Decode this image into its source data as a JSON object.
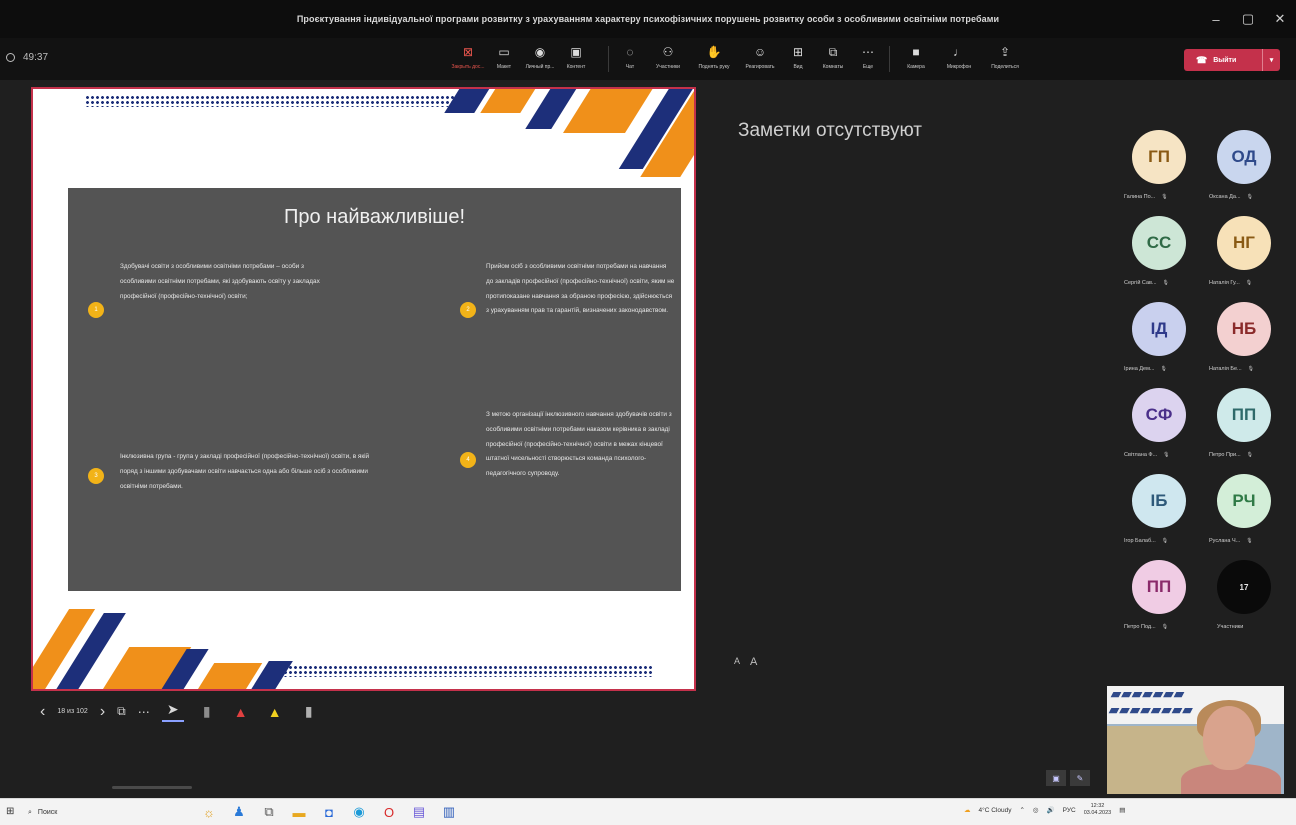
{
  "window": {
    "title": "Проєктування індивідуальної програми розвитку з урахуванням характеру психофізичних порушень розвитку особи з особливими освітніми потребами",
    "minimize": "–",
    "maximize": "▢",
    "close": "✕"
  },
  "toolbar": {
    "timer": "49:37",
    "items": [
      {
        "label": "Закрыть дос...",
        "icon": "share-screen-icon"
      },
      {
        "label": "Макет",
        "icon": "layout-icon"
      },
      {
        "label": "Личный пр...",
        "icon": "broadcast-icon"
      },
      {
        "label": "Контент",
        "icon": "content-icon"
      },
      {
        "label": "Чат",
        "icon": "chat-icon"
      },
      {
        "label": "Участники",
        "icon": "people-icon"
      },
      {
        "label": "Поднять руку",
        "icon": "hand-icon"
      },
      {
        "label": "Реагировать",
        "icon": "emoji-icon"
      },
      {
        "label": "Вид",
        "icon": "grid-icon"
      },
      {
        "label": "Комнаты",
        "icon": "rooms-icon"
      },
      {
        "label": "Еще",
        "icon": "more-icon"
      },
      {
        "label": "Камера",
        "icon": "camera-icon"
      },
      {
        "label": "Микрофон",
        "icon": "mic-icon"
      },
      {
        "label": "Поделиться",
        "icon": "upload-icon"
      }
    ],
    "leave_label": "Выйти"
  },
  "slide": {
    "title": "Про найважливіше!",
    "bullets": [
      {
        "num": "1",
        "text": "Здобувачі освіти з особливими освітніми потребами – особи з особливими освітніми потребами, які здобувають освіту у закладах професійної (професійно-технічної) освіти;"
      },
      {
        "num": "2",
        "text": "Прийом осіб з особливими освітніми потребами на навчання до закладів професійної (професійно-технічної) освіти, яким не протипоказане навчання за обраною професією, здійснюється з урахуванням прав та гарантій, визначених законодавством."
      },
      {
        "num": "3",
        "text": "Інклюзивна група - група у закладі професійної (професійно-технічної) освіти, в якій поряд з іншими здобувачами освіти навчається одна або більше осіб з особливими освітніми потребами."
      },
      {
        "num": "4",
        "text": "З метою організації інклюзивного навчання здобувачів освіти з особливими освітніми потребами наказом керівника в закладі професійної (професійно-технічної) освіти в межах кінцевої штатної чисельності створюється команда психолого-педагогічного супроводу."
      }
    ],
    "counter": "18 из 102"
  },
  "notes": {
    "empty_text": "Заметки отсутствуют",
    "font_small": "A",
    "font_large": "A"
  },
  "participants": [
    {
      "initials": "ГП",
      "name": "Галина По...",
      "bg": "#f6e4c4",
      "fg": "#8a5a14"
    },
    {
      "initials": "ОД",
      "name": "Оксана Да...",
      "bg": "#c9d6ee",
      "fg": "#2f4a8a"
    },
    {
      "initials": "СС",
      "name": "Сергій Сав...",
      "bg": "#cde6d6",
      "fg": "#2f6a46"
    },
    {
      "initials": "НГ",
      "name": "Наталія Гу...",
      "bg": "#f7e1b8",
      "fg": "#8a5a14"
    },
    {
      "initials": "ІД",
      "name": "Ірина Дем...",
      "bg": "#c9d0ee",
      "fg": "#2f3a8a"
    },
    {
      "initials": "НБ",
      "name": "Наталія Бе...",
      "bg": "#f3d0d0",
      "fg": "#8a2a2a"
    },
    {
      "initials": "СФ",
      "name": "Світлана Ф...",
      "bg": "#dcd3ef",
      "fg": "#4a2f8a"
    },
    {
      "initials": "ПП",
      "name": "Петро При...",
      "bg": "#cfeaea",
      "fg": "#2f6a6a"
    },
    {
      "initials": "ІБ",
      "name": "Ігор Балаб...",
      "bg": "#cfe7ef",
      "fg": "#2f5a7a"
    },
    {
      "initials": "РЧ",
      "name": "Руслана Ч...",
      "bg": "#d3eed8",
      "fg": "#2f7a46"
    },
    {
      "initials": "ПП",
      "name": "Петро Под...",
      "bg": "#f0cce4",
      "fg": "#8a2a6a"
    },
    {
      "initials": "17",
      "name": "Участники",
      "bg": "#0a0a0a",
      "fg": "#e8e8e8"
    }
  ],
  "taskbar": {
    "search_placeholder": "Поиск",
    "weather": "4°C Cloudy",
    "lang": "РУС",
    "time": "12:32",
    "date": "03.04.2023"
  },
  "colors": {
    "accent_red": "#c4314b",
    "slide_orange": "#f0901a",
    "slide_navy": "#1d2f7a",
    "bullet_yellow": "#f2b318"
  }
}
